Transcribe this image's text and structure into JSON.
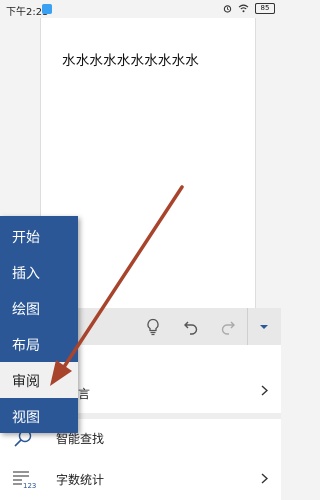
{
  "status_bar": {
    "time": "下午2:23",
    "battery": "85"
  },
  "document": {
    "text": "水水水水水水水水水水"
  },
  "ribbon": {
    "icons": [
      "lightbulb-icon",
      "undo-icon",
      "redo-icon",
      "more-dropdown-icon"
    ]
  },
  "commands": [
    {
      "label": "查",
      "icon": "spell-check-icon",
      "chevron": false
    },
    {
      "label": "语言",
      "icon": "language-icon",
      "chevron": true
    },
    {
      "label": "智能查找",
      "icon": "smart-lookup-icon",
      "chevron": false
    },
    {
      "label": "字数统计",
      "icon": "word-count-icon",
      "chevron": true
    }
  ],
  "tab_menu": {
    "items": [
      "开始",
      "插入",
      "绘图",
      "布局",
      "审阅",
      "视图"
    ],
    "selected": "审阅"
  },
  "colors": {
    "tab_menu_bg": "#2b5797",
    "arrow": "#a8432c"
  }
}
